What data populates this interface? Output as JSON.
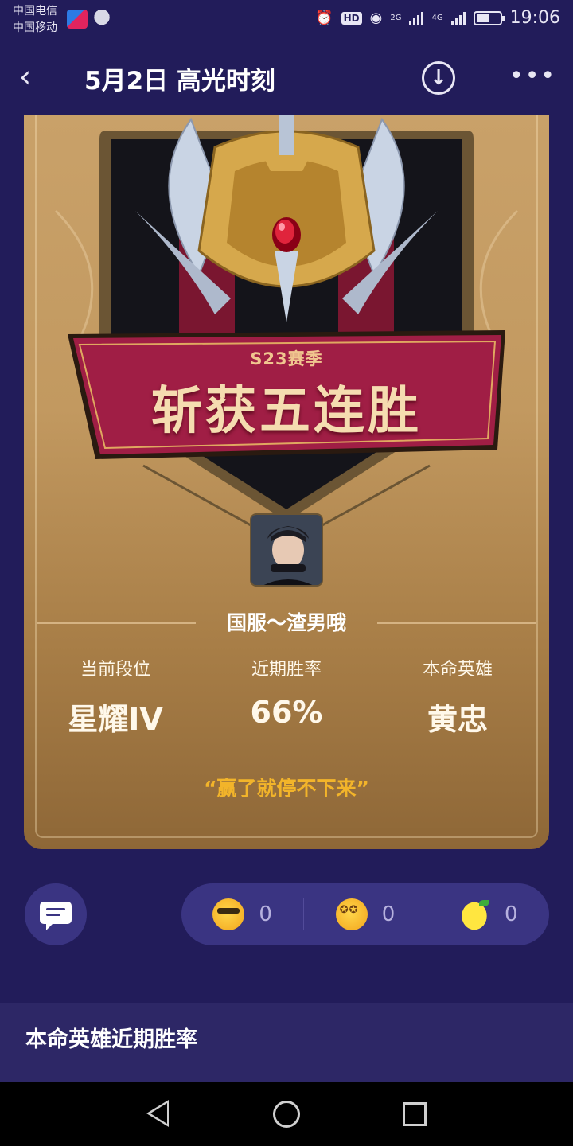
{
  "status_bar": {
    "carrier_1": "中国电信",
    "carrier_2": "中国移动",
    "hd": "HD",
    "net_1": "2G",
    "net_2": "4G",
    "time": "19:06",
    "battery_level": 0.6
  },
  "header": {
    "title": "5月2日 高光时刻",
    "back_icon": "back-chevron-icon",
    "download_icon": "download-icon",
    "more_icon": "more-dots-icon"
  },
  "card": {
    "season": "S23赛季",
    "headline": "斩获五连胜",
    "player_name": "国服～渣男哦",
    "stats": [
      {
        "label": "当前段位",
        "value": "星耀IV"
      },
      {
        "label": "近期胜率",
        "value": "66%"
      },
      {
        "label": "本命英雄",
        "value": "黄忠"
      }
    ],
    "quote": "“赢了就停不下来”"
  },
  "reactions": [
    {
      "icon": "cool-sunglasses-emoji-icon",
      "count": "0"
    },
    {
      "icon": "star-eyes-emoji-icon",
      "count": "0"
    },
    {
      "icon": "lemon-emoji-icon",
      "count": "0"
    }
  ],
  "section": {
    "title": "本命英雄近期胜率"
  },
  "colors": {
    "background": "#221c5a",
    "card_gold": "#c29960",
    "banner_red": "#a01e45",
    "quote_gold": "#f2b42a"
  }
}
